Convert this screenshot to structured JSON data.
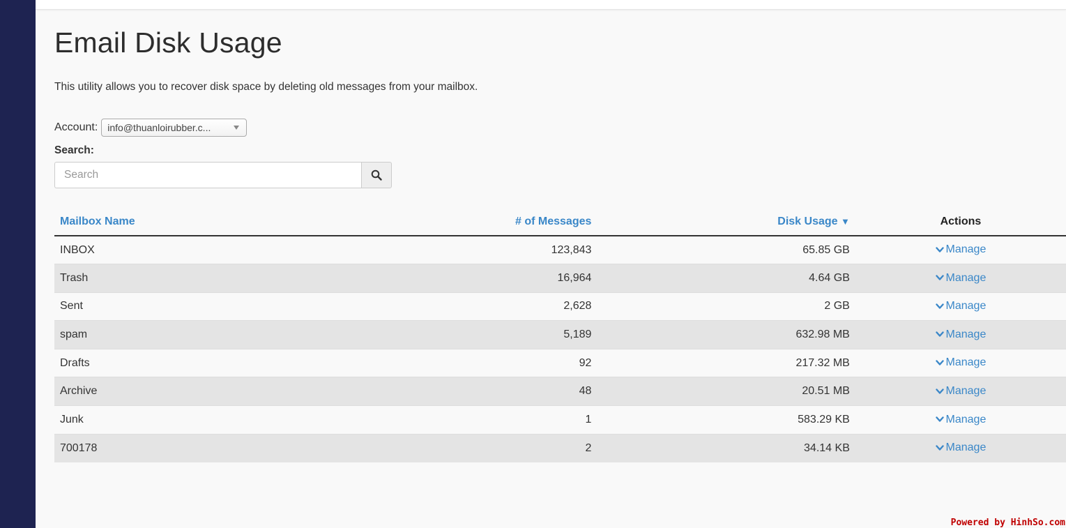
{
  "page": {
    "title": "Email Disk Usage",
    "description": "This utility allows you to recover disk space by deleting old messages from your mailbox."
  },
  "account": {
    "label": "Account:",
    "selected": "info@thuanloirubber.c..."
  },
  "search": {
    "label": "Search:",
    "placeholder": "Search",
    "value": ""
  },
  "table": {
    "columns": {
      "mailbox": "Mailbox Name",
      "messages": "# of Messages",
      "disk_usage": "Disk Usage",
      "sort_indicator": "▼",
      "actions": "Actions"
    },
    "rows": [
      {
        "name": "INBOX",
        "messages": "123,843",
        "usage": "65.85 GB",
        "action": "Manage"
      },
      {
        "name": "Trash",
        "messages": "16,964",
        "usage": "4.64 GB",
        "action": "Manage"
      },
      {
        "name": "Sent",
        "messages": "2,628",
        "usage": "2 GB",
        "action": "Manage"
      },
      {
        "name": "spam",
        "messages": "5,189",
        "usage": "632.98 MB",
        "action": "Manage"
      },
      {
        "name": "Drafts",
        "messages": "92",
        "usage": "217.32 MB",
        "action": "Manage"
      },
      {
        "name": "Archive",
        "messages": "48",
        "usage": "20.51 MB",
        "action": "Manage"
      },
      {
        "name": "Junk",
        "messages": "1",
        "usage": "583.29 KB",
        "action": "Manage"
      },
      {
        "name": "700178",
        "messages": "2",
        "usage": "34.14 KB",
        "action": "Manage"
      }
    ]
  },
  "watermark": "Powered by HinhSo.com",
  "colors": {
    "nav_background": "#1e2351",
    "link": "#3a87c8",
    "stripe": "#e4e4e4",
    "watermark": "#c00000"
  },
  "icons": {
    "search_button": "search-icon",
    "manage": "chevron-down-icon",
    "account_dropdown": "caret-down-icon"
  }
}
